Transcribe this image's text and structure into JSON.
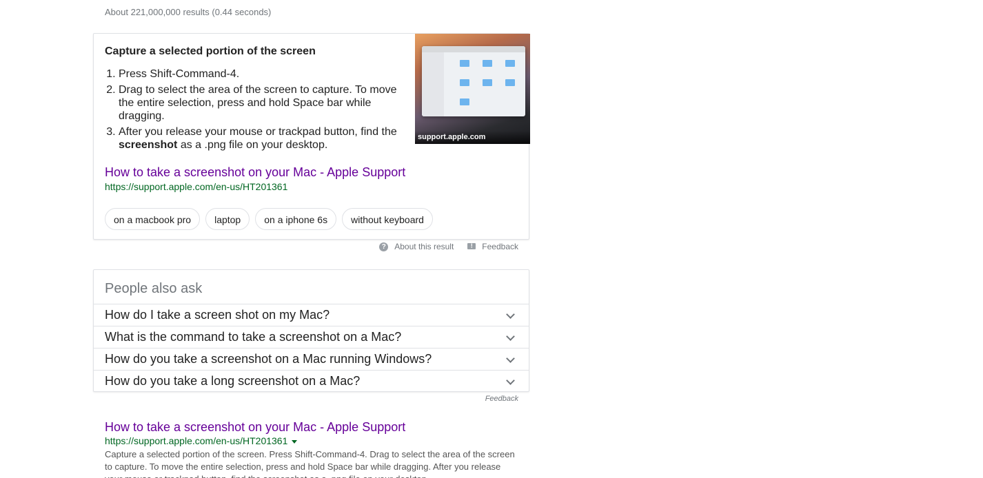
{
  "result_stats": "About 221,000,000 results (0.44 seconds)",
  "snippet": {
    "heading": "Capture a selected portion of the screen",
    "steps": [
      "Press Shift-Command-4.",
      "Drag to select the area of the screen to capture. To move the entire selection, press and hold Space bar while dragging.",
      "After you release your mouse or trackpad button, find the ",
      "screenshot",
      " as a .png file on your desktop."
    ],
    "image_caption": "support.apple.com",
    "link_title": "How to take a screenshot on your Mac - Apple Support",
    "link_url": "https://support.apple.com/en-us/HT201361",
    "chips": [
      "on a macbook pro",
      "laptop",
      "on a iphone 6s",
      "without keyboard"
    ],
    "about_label": "About this result",
    "feedback_label": "Feedback"
  },
  "people_also_ask": {
    "title": "People also ask",
    "questions": [
      "How do I take a screen shot on my Mac?",
      "What is the command to take a screenshot on a Mac?",
      "How do you take a screenshot on a Mac running Windows?",
      "How do you take a long screenshot on a Mac?"
    ],
    "feedback_label": "Feedback"
  },
  "result": {
    "title": "How to take a screenshot on your Mac - Apple Support",
    "url": "https://support.apple.com/en-us/HT201361",
    "description": "Capture a selected portion of the screen. Press Shift-Command-4. Drag to select the area of the screen to capture. To move the entire selection, press and hold Space bar while dragging. After you release your mouse or trackpad button, find the screenshot as a .png file on your desktop."
  },
  "colors": {
    "visited_link": "#660099",
    "url_green": "#006621",
    "muted_text": "#70757a",
    "border": "#dfe1e5"
  },
  "icons": {
    "about": "question-circle-icon",
    "feedback": "feedback-flag-icon",
    "expand": "chevron-down-icon",
    "url_menu": "caret-down-icon"
  }
}
